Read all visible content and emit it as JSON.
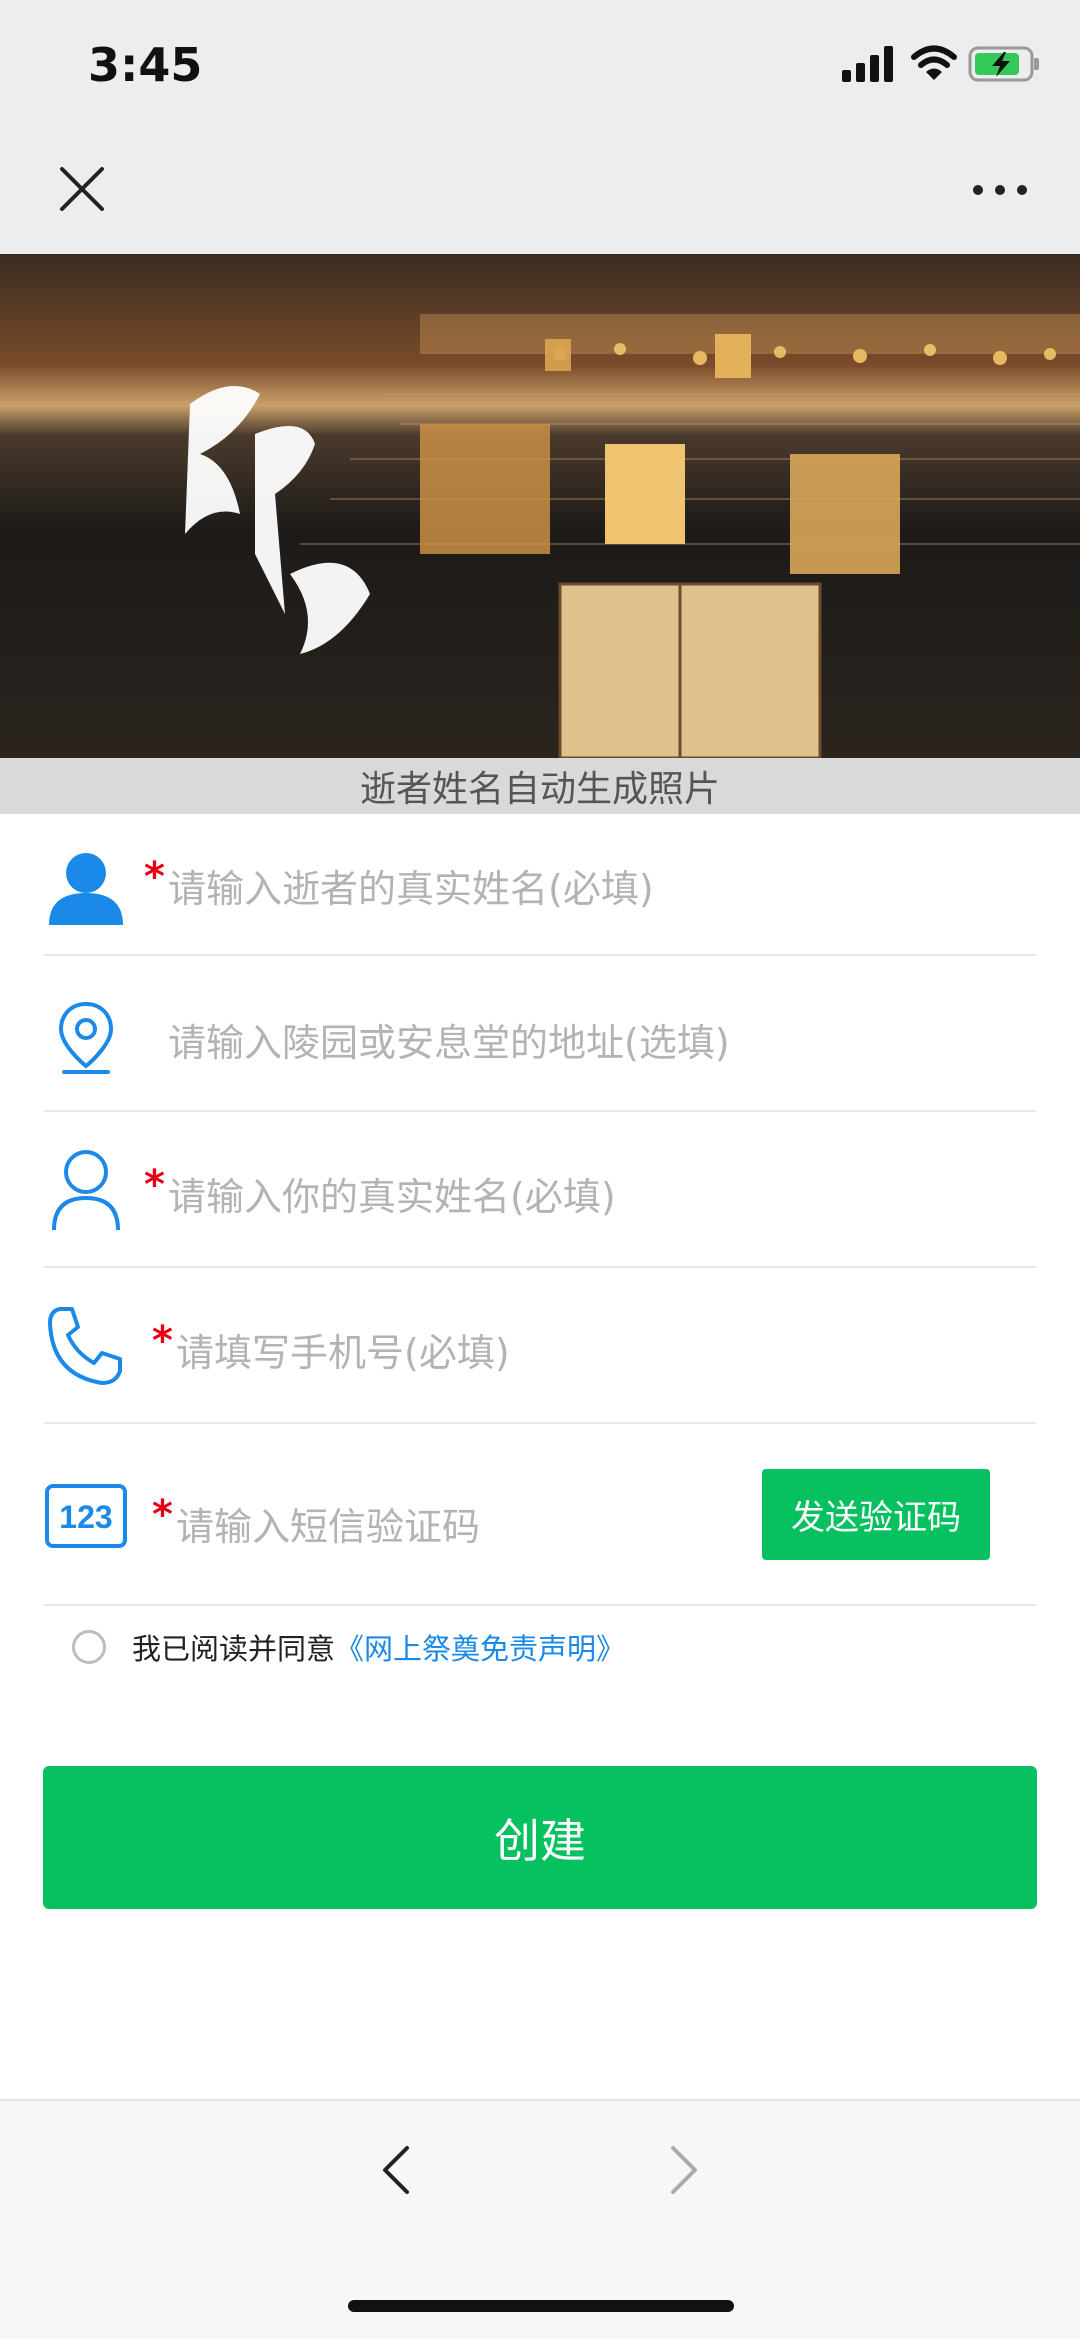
{
  "status_bar": {
    "time": "3:45"
  },
  "banner": {
    "title_chars": "祈福",
    "caption": "逝者姓名自动生成照片"
  },
  "form": {
    "deceased_name": {
      "required": "*",
      "placeholder": "请输入逝者的真实姓名(必填)"
    },
    "address": {
      "placeholder": "请输入陵园或安息堂的地址(选填)"
    },
    "your_name": {
      "required": "*",
      "placeholder": "请输入你的真实姓名(必填)"
    },
    "phone": {
      "required": "*",
      "placeholder": "请填写手机号(必填)"
    },
    "sms_code": {
      "required": "*",
      "placeholder": "请输入短信验证码",
      "icon_text": "123"
    },
    "send_code_label": "发送验证码"
  },
  "agreement": {
    "prefix": "我已阅读并同意",
    "link": "《网上祭奠免责声明》"
  },
  "create_label": "创建",
  "colors": {
    "green": "#07c160",
    "icon_blue": "#1a89e8",
    "required_red": "#e60012",
    "placeholder_gray": "#b3b3b3"
  },
  "icons": [
    "close-icon",
    "more-icon",
    "person-filled-icon",
    "location-pin-icon",
    "person-outline-icon",
    "phone-icon",
    "code-123-icon",
    "back-icon",
    "forward-icon"
  ]
}
